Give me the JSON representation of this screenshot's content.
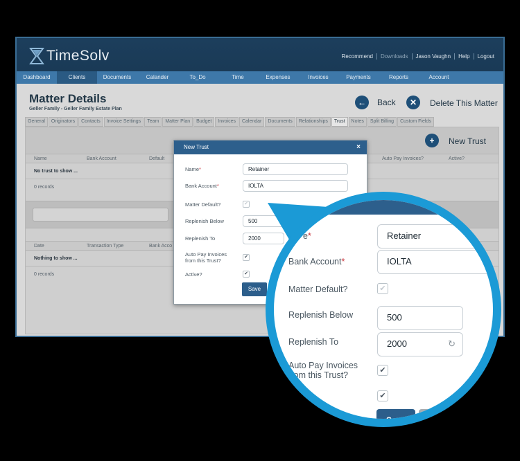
{
  "app": {
    "logo_text": "TimeSolv",
    "top_links": [
      "Recommend",
      "Downloads",
      "Jason Vaughn",
      "Help",
      "Logout"
    ],
    "nav": [
      "Dashboard",
      "Clients",
      "Documents",
      "Calander",
      "To_Do",
      "Time",
      "Expenses",
      "Invoices",
      "Payments",
      "Reports",
      "Account"
    ],
    "nav_active": "Clients"
  },
  "page": {
    "title": "Matter Details",
    "subtitle": "Geller Family - Geller Family Estate Plan",
    "back_label": "Back",
    "delete_label": "Delete This Matter",
    "new_trust_label": "New Trust",
    "subtabs": [
      "General",
      "Originators",
      "Contacts",
      "Invoice Settings",
      "Team",
      "Matter Plan",
      "Budget",
      "Invoices",
      "Calendar",
      "Documents",
      "Relationships",
      "Trust",
      "Notes",
      "Split Billing",
      "Custom Fields"
    ],
    "subtab_active": "Trust"
  },
  "trust_grid": {
    "columns": [
      "Name",
      "Bank Account",
      "Default",
      "Auto Pay Invoices?",
      "Active?"
    ],
    "empty_text": "No trust to show ...",
    "count": "0 records"
  },
  "transaction_grid": {
    "columns": [
      "Date",
      "Transaction Type",
      "Bank Acco"
    ],
    "empty_text": "Nothing to show ...",
    "count": "0 records"
  },
  "modal": {
    "title": "New Trust",
    "close": "×",
    "name_label": "Name",
    "name_value": "Retainer",
    "bank_label": "Bank Account",
    "bank_value": "IOLTA",
    "default_label": "Matter Default?",
    "replenish_below_label": "Replenish Below",
    "replenish_below_value": "500",
    "replenish_to_label": "Replenish To",
    "replenish_to_value": "2000",
    "autopay_label_1": "Auto Pay Invoices",
    "autopay_label_2": "from this Trust?",
    "active_label": "Active?",
    "save_label": "Save",
    "required_mark": "*",
    "check_mark": "✔"
  },
  "zoom": {
    "name_label_partial": "e",
    "bank_label": "Bank Account",
    "name_value": "Retainer",
    "bank_value": "IOLTA",
    "default_label": "Matter Default?",
    "replenish_below_label": "Replenish Below",
    "replenish_below_value": "500",
    "replenish_to_label": "Replenish To",
    "replenish_to_value": "2000",
    "autopay_label_1": "Auto Pay Invoices",
    "autopay_label_2": "from this Trust?",
    "active_label_partial": "ve?",
    "save_label": "Save",
    "cancel_label_partial": "Ca",
    "refresh_glyph": "↻"
  },
  "colors": {
    "accent": "#1b9ad6",
    "header_blue": "#2d5f8c",
    "topbar": "#1c3e5c",
    "required": "#c8323a"
  },
  "icons": {
    "back": "arrow-left-icon",
    "delete": "close-icon",
    "new_trust": "plus-icon"
  }
}
